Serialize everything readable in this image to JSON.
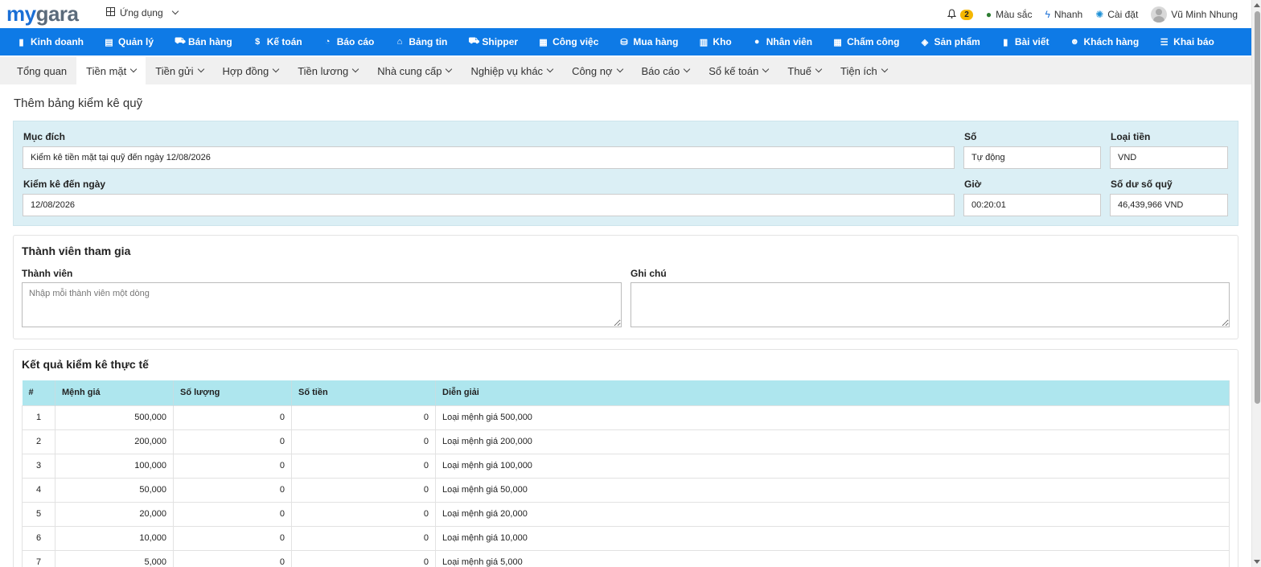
{
  "brand": {
    "logo_part1": "my",
    "logo_part2": "gara"
  },
  "app_menu": {
    "label": "Ứng dụng"
  },
  "top_right": {
    "notification_count": "2",
    "color_label": "Màu sắc",
    "quick_label": "Nhanh",
    "settings_label": "Cài đặt",
    "user_name": "Vũ Minh Nhung"
  },
  "main_nav": [
    {
      "label": "Kinh doanh",
      "icon": "briefcase-icon",
      "glyph": "▮"
    },
    {
      "label": "Quản lý",
      "icon": "id-card-icon",
      "glyph": "▤"
    },
    {
      "label": "Bán hàng",
      "icon": "cart-icon",
      "glyph": "⛟"
    },
    {
      "label": "Kế toán",
      "icon": "dollar-icon",
      "glyph": "$"
    },
    {
      "label": "Báo cáo",
      "icon": "pie-chart-icon",
      "glyph": "◔"
    },
    {
      "label": "Bảng tin",
      "icon": "home-icon",
      "glyph": "⌂"
    },
    {
      "label": "Shipper",
      "icon": "truck-icon",
      "glyph": "⛟"
    },
    {
      "label": "Công việc",
      "icon": "calendar-icon",
      "glyph": "▦"
    },
    {
      "label": "Mua hàng",
      "icon": "basket-icon",
      "glyph": "⛁"
    },
    {
      "label": "Kho",
      "icon": "warehouse-icon",
      "glyph": "▥"
    },
    {
      "label": "Nhân viên",
      "icon": "user-icon",
      "glyph": "●"
    },
    {
      "label": "Chấm công",
      "icon": "calendar-check-icon",
      "glyph": "▦"
    },
    {
      "label": "Sản phẩm",
      "icon": "box-icon",
      "glyph": "◈"
    },
    {
      "label": "Bài viết",
      "icon": "book-icon",
      "glyph": "▮"
    },
    {
      "label": "Khách hàng",
      "icon": "smile-icon",
      "glyph": "☻"
    },
    {
      "label": "Khai báo",
      "icon": "list-icon",
      "glyph": "☰"
    }
  ],
  "sub_nav": [
    {
      "label": "Tổng quan",
      "dropdown": false,
      "active": false
    },
    {
      "label": "Tiền mặt",
      "dropdown": true,
      "active": true
    },
    {
      "label": "Tiền gửi",
      "dropdown": true,
      "active": false
    },
    {
      "label": "Hợp đồng",
      "dropdown": true,
      "active": false
    },
    {
      "label": "Tiền lương",
      "dropdown": true,
      "active": false
    },
    {
      "label": "Nhà cung cấp",
      "dropdown": true,
      "active": false
    },
    {
      "label": "Nghiệp vụ khác",
      "dropdown": true,
      "active": false
    },
    {
      "label": "Công nợ",
      "dropdown": true,
      "active": false
    },
    {
      "label": "Báo cáo",
      "dropdown": true,
      "active": false
    },
    {
      "label": "Sổ kế toán",
      "dropdown": true,
      "active": false
    },
    {
      "label": "Thuế",
      "dropdown": true,
      "active": false
    },
    {
      "label": "Tiện ích",
      "dropdown": true,
      "active": false
    }
  ],
  "page_title": "Thêm bảng kiểm kê quỹ",
  "form": {
    "purpose_label": "Mục đích",
    "purpose_value": "Kiểm kê tiền mặt tại quỹ đến ngày 12/08/2026",
    "number_label": "Số",
    "number_value": "Tự động",
    "currency_label": "Loại tiền",
    "currency_value": "VND",
    "date_label": "Kiểm kê đến ngày",
    "date_value": "12/08/2026",
    "time_label": "Giờ",
    "time_value": "00:20:01",
    "balance_label": "Số dư số quỹ",
    "balance_value": "46,439,966 VND"
  },
  "members": {
    "title": "Thành viên tham gia",
    "members_label": "Thành viên",
    "members_placeholder": "Nhập mỗi thành viên một dòng",
    "note_label": "Ghi chú",
    "note_value": ""
  },
  "results": {
    "title": "Kết quả kiểm kê thực tế",
    "columns": [
      "#",
      "Mệnh giá",
      "Số lượng",
      "Số tiền",
      "Diễn giải"
    ],
    "rows": [
      {
        "no": "1",
        "denomination": "500,000",
        "qty": "0",
        "amount": "0",
        "desc": "Loại mệnh giá 500,000"
      },
      {
        "no": "2",
        "denomination": "200,000",
        "qty": "0",
        "amount": "0",
        "desc": "Loại mệnh giá 200,000"
      },
      {
        "no": "3",
        "denomination": "100,000",
        "qty": "0",
        "amount": "0",
        "desc": "Loại mệnh giá 100,000"
      },
      {
        "no": "4",
        "denomination": "50,000",
        "qty": "0",
        "amount": "0",
        "desc": "Loại mệnh giá 50,000"
      },
      {
        "no": "5",
        "denomination": "20,000",
        "qty": "0",
        "amount": "0",
        "desc": "Loại mệnh giá 20,000"
      },
      {
        "no": "6",
        "denomination": "10,000",
        "qty": "0",
        "amount": "0",
        "desc": "Loại mệnh giá 10,000"
      },
      {
        "no": "7",
        "denomination": "5,000",
        "qty": "0",
        "amount": "0",
        "desc": "Loại mệnh giá 5,000"
      }
    ]
  },
  "colors": {
    "nav_blue": "#0e7ae6",
    "panel_bg": "#dbeff5",
    "table_header": "#aee6ee",
    "badge": "#f5b700"
  }
}
